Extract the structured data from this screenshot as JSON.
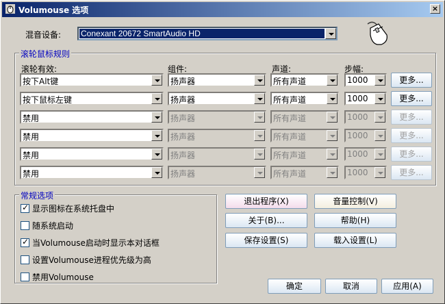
{
  "window": {
    "title": "Volumouse 选项",
    "close": "×"
  },
  "mixer": {
    "label": "混音设备:",
    "value": "Conexant 20672 SmartAudio HD"
  },
  "wheel_rules": {
    "title": "滚轮鼠标规则",
    "headers": {
      "wheel_active": "滚轮有效:",
      "component": "组件:",
      "channel": "声道:",
      "step": "步幅:"
    },
    "rows": [
      {
        "wheel": "按下Alt键",
        "component": "扬声器",
        "channel": "所有声道",
        "step": "1000",
        "more": "更多...",
        "enabled": true
      },
      {
        "wheel": "按下鼠标左键",
        "component": "扬声器",
        "channel": "所有声道",
        "step": "1000",
        "more": "更多...",
        "enabled": true
      },
      {
        "wheel": "禁用",
        "component": "扬声器",
        "channel": "所有声道",
        "step": "1000",
        "more": "更多...",
        "enabled": false
      },
      {
        "wheel": "禁用",
        "component": "扬声器",
        "channel": "所有声道",
        "step": "1000",
        "more": "更多...",
        "enabled": false
      },
      {
        "wheel": "禁用",
        "component": "扬声器",
        "channel": "所有声道",
        "step": "1000",
        "more": "更多...",
        "enabled": false
      },
      {
        "wheel": "禁用",
        "component": "扬声器",
        "channel": "所有声道",
        "step": "1000",
        "more": "更多...",
        "enabled": false
      }
    ]
  },
  "general": {
    "title": "常规选项",
    "options": [
      {
        "label": "显示图标在系统托盘中",
        "checked": true
      },
      {
        "label": "随系统启动",
        "checked": false
      },
      {
        "label": "当Volumouse启动时显示本对话框",
        "checked": true
      },
      {
        "label": "设置Volumouse进程优先级为高",
        "checked": false
      },
      {
        "label": "禁用Volumouse",
        "checked": false
      }
    ]
  },
  "actions": {
    "exit": "退出程序(X)",
    "volume_control": "音量控制(V)",
    "about": "关于(B)...",
    "help": "帮助(H)",
    "save": "保存设置(S)",
    "load": "载入设置(L)"
  },
  "footer": {
    "ok": "确定",
    "cancel": "取消",
    "apply": "应用(A)"
  },
  "colors": {
    "titlebar_start": "#0a246a",
    "titlebar_end": "#a6caf0",
    "group_title": "#0000c0",
    "face": "#d4d0c8"
  }
}
